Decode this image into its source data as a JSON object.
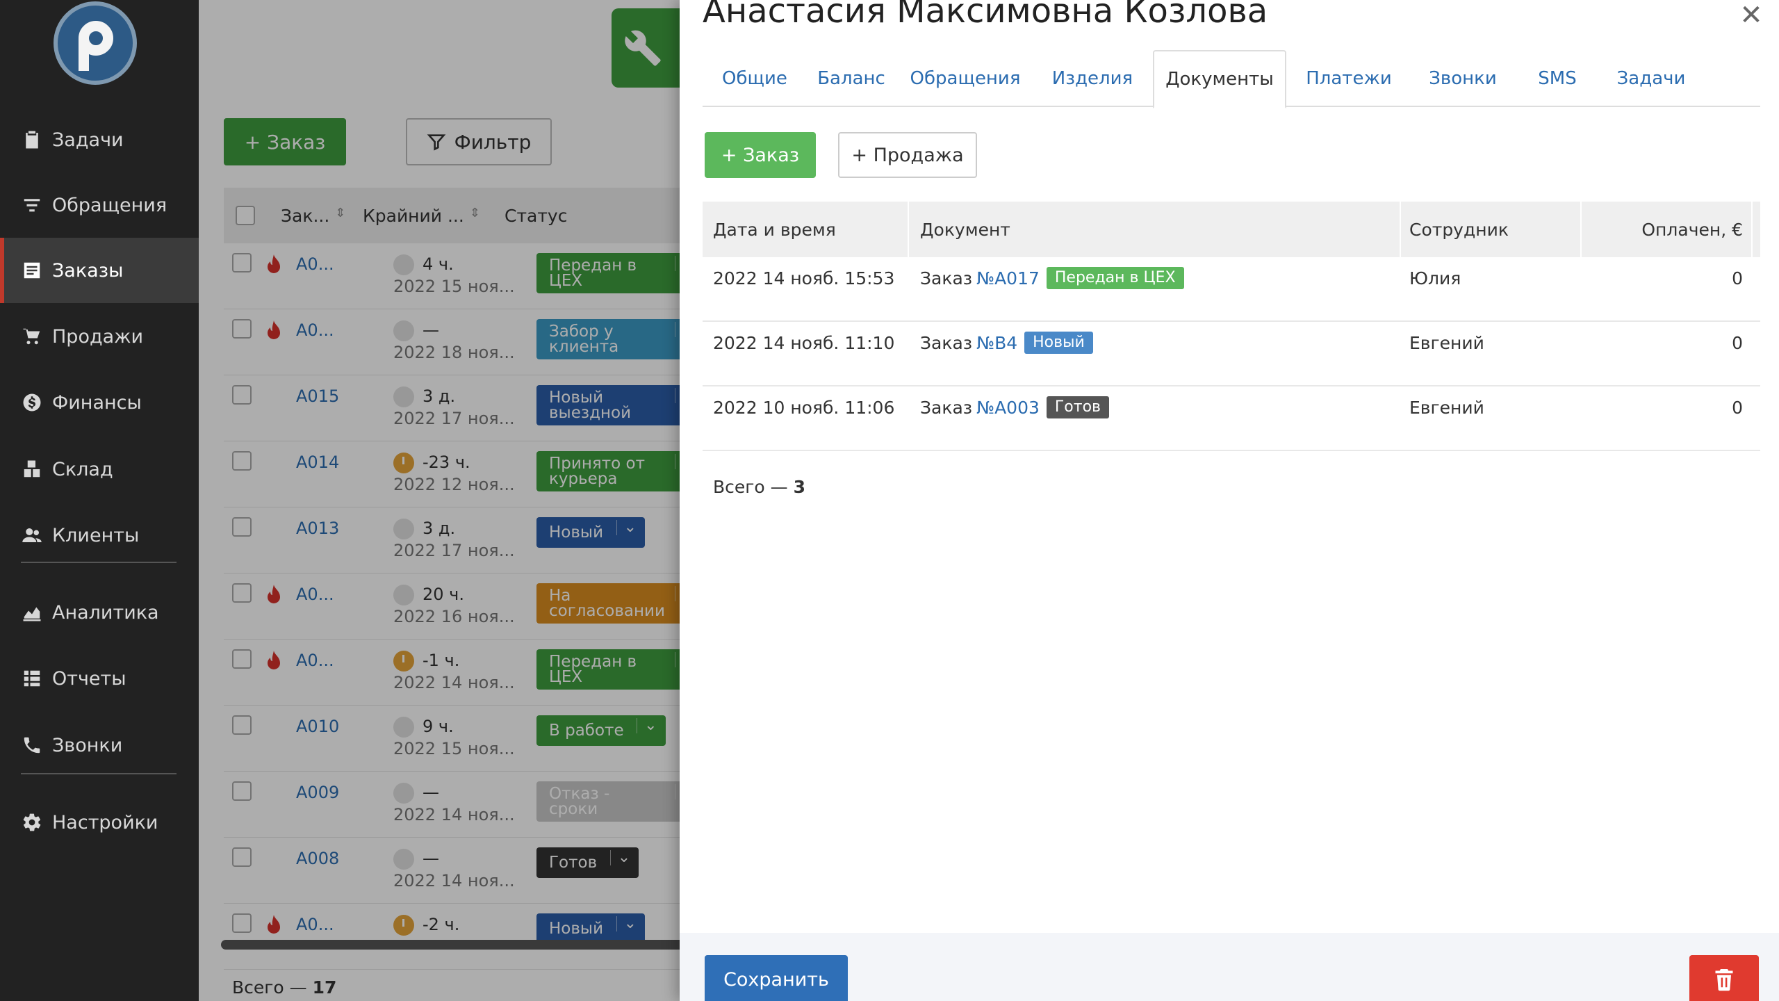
{
  "sidebar": {
    "items": [
      {
        "label": "Задачи",
        "icon": "clipboard-icon"
      },
      {
        "label": "Обращения",
        "icon": "filter-lines-icon"
      },
      {
        "label": "Заказы",
        "icon": "list-icon"
      },
      {
        "label": "Продажи",
        "icon": "cart-icon"
      },
      {
        "label": "Финансы",
        "icon": "dollar-icon"
      },
      {
        "label": "Склад",
        "icon": "boxes-icon"
      },
      {
        "label": "Клиенты",
        "icon": "users-icon"
      },
      {
        "label": "Аналитика",
        "icon": "chart-icon"
      },
      {
        "label": "Отчеты",
        "icon": "report-icon"
      },
      {
        "label": "Звонки",
        "icon": "phone-icon"
      },
      {
        "label": "Настройки",
        "icon": "gear-icon"
      }
    ],
    "active": "Заказы"
  },
  "orders": {
    "add_label": "+ Заказ",
    "filter_label": "Фильтр",
    "columns": [
      "Зак...",
      "Крайний ...",
      "Статус"
    ],
    "rows": [
      {
        "id": "A0...",
        "fire": true,
        "late": false,
        "deadline": "4 ч.",
        "date": "2022 15 ноя...",
        "status": "Передан в ЦЕХ",
        "color": "#3f9d3f"
      },
      {
        "id": "A0...",
        "fire": true,
        "late": false,
        "deadline": "—",
        "date": "2022 18 ноя...",
        "status": "Забор у клиента",
        "color": "#3b9ac4"
      },
      {
        "id": "A015",
        "fire": false,
        "late": false,
        "deadline": "3 д.",
        "date": "2022 17 ноя...",
        "status": "Новый выездной",
        "color": "#2c5ea8"
      },
      {
        "id": "A014",
        "fire": false,
        "late": true,
        "deadline": "-23 ч.",
        "date": "2022 12 ноя...",
        "status": "Принято от курьера",
        "color": "#3f9d3f"
      },
      {
        "id": "A013",
        "fire": false,
        "late": false,
        "deadline": "3 д.",
        "date": "2022 17 ноя...",
        "status": "Новый",
        "color": "#2c5ea8"
      },
      {
        "id": "A0...",
        "fire": true,
        "late": false,
        "deadline": "20 ч.",
        "date": "2022 16 ноя...",
        "status": "На согласовании",
        "color": "#d98c1f"
      },
      {
        "id": "A0...",
        "fire": true,
        "late": true,
        "deadline": "-1 ч.",
        "date": "2022 14 ноя...",
        "status": "Передан в ЦЕХ",
        "color": "#3f9d3f"
      },
      {
        "id": "A010",
        "fire": false,
        "late": false,
        "deadline": "9 ч.",
        "date": "2022 15 ноя...",
        "status": "В работе",
        "color": "#3f9d3f"
      },
      {
        "id": "A009",
        "fire": false,
        "late": false,
        "deadline": "—",
        "date": "2022 14 ноя...",
        "status": "Отказ - сроки",
        "color": "#c9c9c9"
      },
      {
        "id": "A008",
        "fire": false,
        "late": false,
        "deadline": "—",
        "date": "2022 14 ноя...",
        "status": "Готов",
        "color": "#333333"
      },
      {
        "id": "A0...",
        "fire": true,
        "late": true,
        "deadline": "-2 ч.",
        "date": "",
        "status": "Новый",
        "color": "#2c5ea8"
      }
    ],
    "footer_label": "Всего — ",
    "footer_count": "17"
  },
  "panel": {
    "title": "Анастасия Максимовна Козлова",
    "tabs": [
      "Общие",
      "Баланс",
      "Обращения",
      "Изделия",
      "Документы",
      "Платежи",
      "Звонки",
      "SMS",
      "Задачи"
    ],
    "active_tab": "Документы",
    "add_order_label": "+ Заказ",
    "add_sale_label": "+ Продажа",
    "table": {
      "headers": {
        "datetime": "Дата и время",
        "document": "Документ",
        "employee": "Сотрудник",
        "paid": "Оплачен, €"
      },
      "rows": [
        {
          "datetime": "2022 14 нояб. 15:53",
          "doc_prefix": "Заказ",
          "doc_link": "№A017",
          "badge": "Передан в ЦЕХ",
          "badge_color": "#5cb85c",
          "employee": "Юлия",
          "paid": "0"
        },
        {
          "datetime": "2022 14 нояб. 11:10",
          "doc_prefix": "Заказ",
          "doc_link": "№B4",
          "badge": "Новый",
          "badge_color": "#4a89c8",
          "employee": "Евгений",
          "paid": "0"
        },
        {
          "datetime": "2022 10 нояб. 11:06",
          "doc_prefix": "Заказ",
          "doc_link": "№A003",
          "badge": "Готов",
          "badge_color": "#555555",
          "employee": "Евгений",
          "paid": "0"
        }
      ],
      "total_label": "Всего — ",
      "total_count": "3"
    },
    "save_label": "Сохранить"
  }
}
